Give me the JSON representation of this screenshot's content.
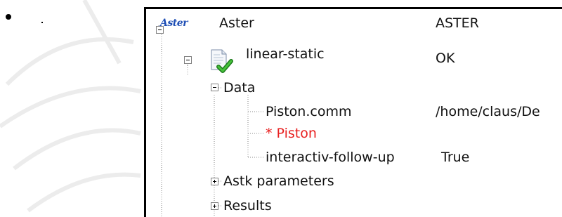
{
  "tree": {
    "nodes": [
      {
        "id": "aster",
        "label": "Aster",
        "value": "ASTER",
        "logo": "Aster",
        "expander": "minus"
      },
      {
        "id": "linear-static",
        "label": "linear-static",
        "value": "OK",
        "expander": "minus",
        "icon": "document-check-icon"
      },
      {
        "id": "data",
        "label": "Data",
        "value": "",
        "expander": "minus"
      },
      {
        "id": "piston-comm",
        "label": "Piston.comm",
        "value": "/home/claus/De"
      },
      {
        "id": "piston",
        "label": "* Piston",
        "value": "",
        "color": "#e81e1e"
      },
      {
        "id": "interactiv",
        "label": "interactiv-follow-up",
        "value": "True"
      },
      {
        "id": "astk",
        "label": "Astk parameters",
        "value": "",
        "expander": "plus"
      },
      {
        "id": "results",
        "label": "Results",
        "value": "",
        "expander": "plus"
      }
    ]
  },
  "colors": {
    "accent_red": "#e81e1e",
    "logo_blue": "#1f4fb5"
  }
}
